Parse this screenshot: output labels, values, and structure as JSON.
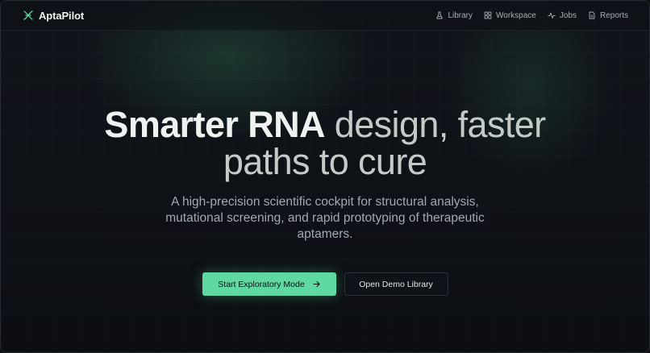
{
  "nav": {
    "brand": "AptaPilot",
    "links": [
      {
        "label": "Library",
        "icon": "flask-icon"
      },
      {
        "label": "Workspace",
        "icon": "grid-icon"
      },
      {
        "label": "Jobs",
        "icon": "activity-icon"
      },
      {
        "label": "Reports",
        "icon": "file-icon"
      }
    ]
  },
  "hero": {
    "headline_strong": "Smarter RNA",
    "headline_rest_1": " design, faster",
    "headline_rest_2": "paths to cure",
    "subtitle": "A high-precision scientific cockpit for structural analysis, mutational screening, and rapid prototyping of therapeutic aptamers.",
    "primary_cta": "Start Exploratory Mode",
    "secondary_cta": "Open Demo Library"
  },
  "colors": {
    "accent": "#5fd8a2",
    "background": "#0d0f13"
  }
}
